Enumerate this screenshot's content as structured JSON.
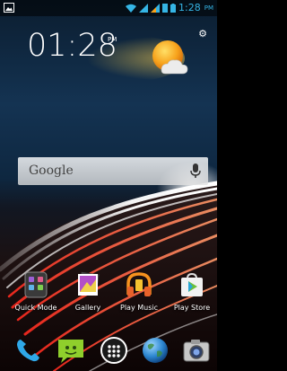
{
  "status_bar": {
    "time": "1:28",
    "ampm": "PM",
    "icons": [
      "image-notification-icon",
      "wifi-icon",
      "signal-icon",
      "signal-icon",
      "sim-icon",
      "battery-icon"
    ]
  },
  "clock_widget": {
    "time": "01:28",
    "ampm": "PM",
    "weather_icon": "sun-cloud-icon",
    "settings_icon": "gear-icon"
  },
  "search_bar": {
    "label": "Google",
    "icon": "mic-icon"
  },
  "apps": [
    {
      "label": "Quick Mode",
      "icon": "quick-mode-icon"
    },
    {
      "label": "Gallery",
      "icon": "gallery-icon"
    },
    {
      "label": "Play Music",
      "icon": "play-music-icon"
    },
    {
      "label": "Play Store",
      "icon": "play-store-icon"
    }
  ],
  "dock": [
    {
      "icon": "phone-icon"
    },
    {
      "icon": "messaging-icon"
    },
    {
      "icon": "app-drawer-icon"
    },
    {
      "icon": "browser-icon"
    },
    {
      "icon": "camera-icon"
    }
  ],
  "colors": {
    "accent": "#35b5e5",
    "sun": "#f7a21b",
    "streak_red": "#e8322a",
    "streak_white": "#ffffff"
  }
}
